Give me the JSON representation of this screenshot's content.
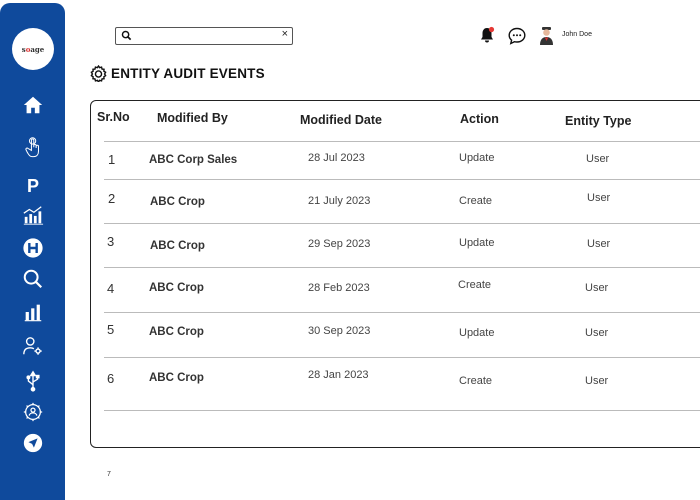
{
  "app": {
    "logo_text_a": "s",
    "logo_text_b": "o",
    "logo_text_c": "age"
  },
  "sidebar": {
    "items": [
      {
        "icon": "home-icon"
      },
      {
        "icon": "touch-hand-icon"
      },
      {
        "icon": "p-letter-icon",
        "label": "P"
      },
      {
        "icon": "bar-growth-icon"
      },
      {
        "icon": "h-circle-icon"
      },
      {
        "icon": "search-icon"
      },
      {
        "icon": "bar-chart-icon"
      },
      {
        "icon": "user-settings-icon"
      },
      {
        "icon": "usb-icon"
      },
      {
        "icon": "team-settings-icon"
      },
      {
        "icon": "navigation-icon"
      }
    ]
  },
  "header": {
    "search_placeholder": "",
    "clear_label": "×",
    "user_name": "John Doe"
  },
  "page": {
    "title": "ENTITY AUDIT EVENTS"
  },
  "table": {
    "headers": {
      "sr": "Sr.No",
      "modified_by": "Modified By",
      "modified_date": "Modified Date",
      "action": "Action",
      "entity_type": "Entity Type"
    },
    "rows": [
      {
        "sr": "1",
        "modified_by": "ABC Corp Sales",
        "modified_date": "28 Jul 2023",
        "action": "Update",
        "entity_type": "User"
      },
      {
        "sr": "2",
        "modified_by": "ABC Crop",
        "modified_date": "21 July 2023",
        "action": "Create",
        "entity_type": "User"
      },
      {
        "sr": "3",
        "modified_by": "ABC Crop",
        "modified_date": "29 Sep 2023",
        "action": "Update",
        "entity_type": "User"
      },
      {
        "sr": "4",
        "modified_by": "ABC Crop",
        "modified_date": "28 Feb 2023",
        "action": "Create",
        "entity_type": "User"
      },
      {
        "sr": "5",
        "modified_by": "ABC Crop",
        "modified_date": "30 Sep 2023",
        "action": "Update",
        "entity_type": "User"
      },
      {
        "sr": "6",
        "modified_by": "ABC Crop",
        "modified_date": "28 Jan 2023",
        "action": "Create",
        "entity_type": "User"
      }
    ]
  },
  "footer": {
    "page_number": "7"
  },
  "colors": {
    "sidebar": "#0f4a9c",
    "notification_dot": "#e53935"
  }
}
